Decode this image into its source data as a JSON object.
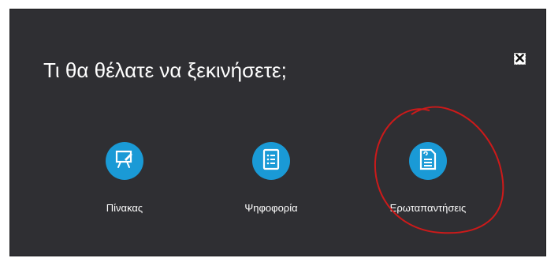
{
  "dialog": {
    "title": "Τι θα θέλατε να ξεκινήσετε;",
    "close_icon": "close-icon",
    "options": [
      {
        "label": "Πίνακας",
        "icon": "whiteboard-icon",
        "accent": "#1a9ad6"
      },
      {
        "label": "Ψηφοφορία",
        "icon": "poll-icon",
        "accent": "#1a9ad6"
      },
      {
        "label": "Ερωταπαντήσεις",
        "icon": "qa-icon",
        "accent": "#1a9ad6"
      }
    ]
  },
  "colors": {
    "dialog_bg": "#2f2f33",
    "accent": "#1a9ad6",
    "annotation": "#cc1a1a"
  }
}
